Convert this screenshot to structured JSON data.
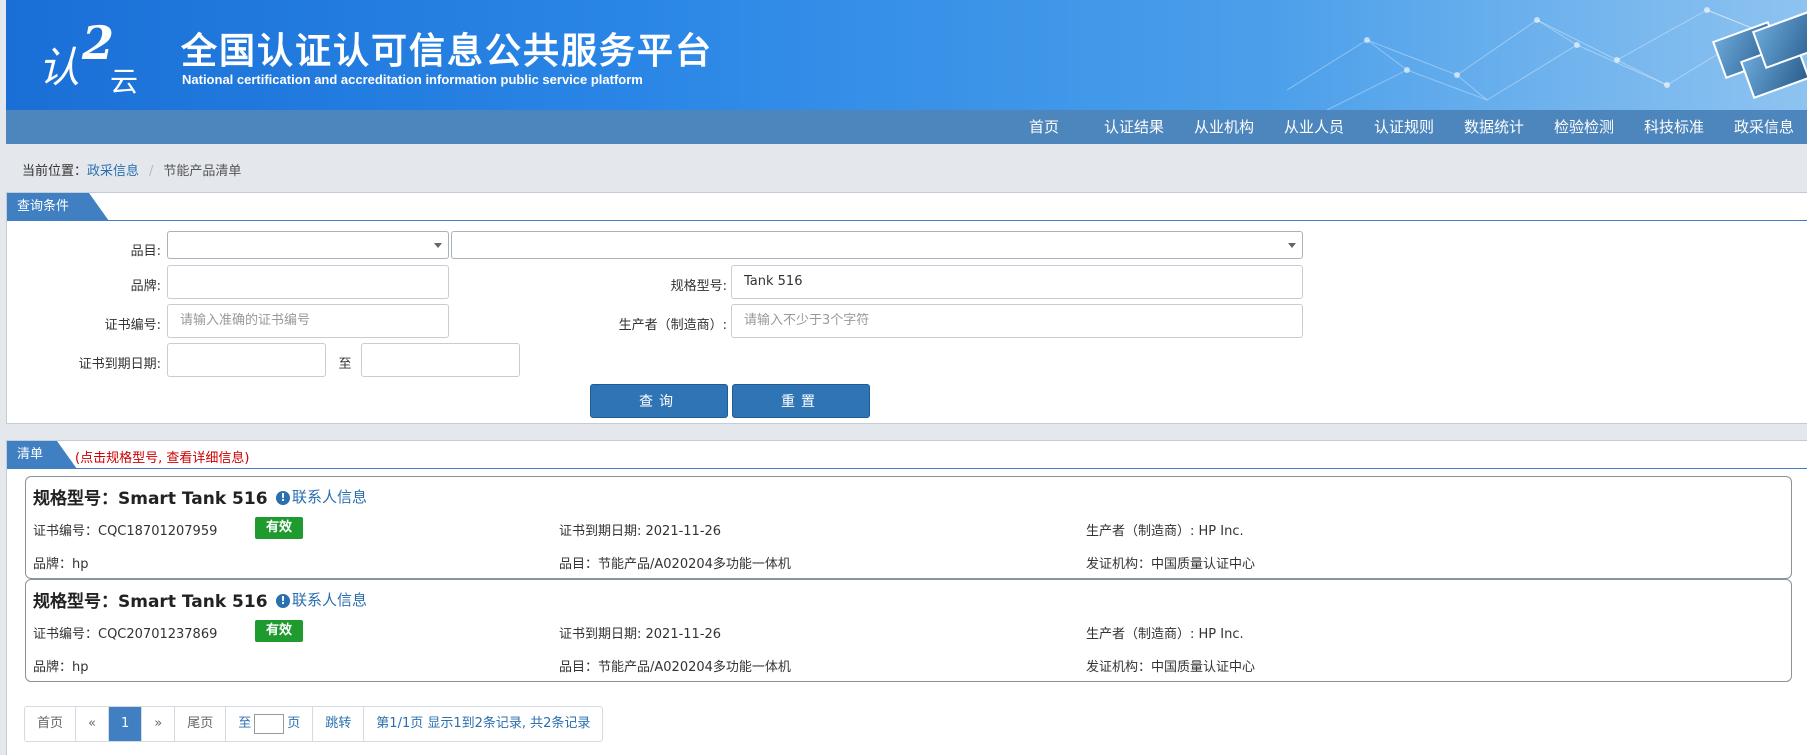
{
  "header": {
    "logo_text": "认证云",
    "title": "全国认证认可信息公共服务平台",
    "subtitle": "National certification and accreditation information public service platform"
  },
  "nav": [
    "首页",
    "认证结果",
    "从业机构",
    "从业人员",
    "认证规则",
    "数据统计",
    "检验检测",
    "科技标准",
    "政采信息"
  ],
  "breadcrumb": {
    "prefix": "当前位置：",
    "parent": "政采信息",
    "separator": "/",
    "current": "节能产品清单"
  },
  "query": {
    "tab": "查询条件",
    "category_label": "品目:",
    "category_value_1": "",
    "category_value_2": "",
    "brand_label": "品牌:",
    "brand_value": "",
    "model_label": "规格型号:",
    "model_value": "Tank 516",
    "cert_no_label": "证书编号:",
    "cert_no_placeholder": "请输入准确的证书编号",
    "maker_label": "生产者（制造商）:",
    "maker_placeholder": "请输入不少于3个字符",
    "expiry_label": "证书到期日期:",
    "expiry_to": "至",
    "search_btn": "查询",
    "reset_btn": "重置"
  },
  "list": {
    "tab": "清单",
    "hint": "(点击规格型号, 查看详细信息)",
    "model_prefix": "规格型号：",
    "contact": "联系人信息",
    "items": [
      {
        "model": "Smart Tank 516",
        "cert_no": "证书编号：CQC18701207959",
        "status": "有效",
        "expiry": "证书到期日期: 2021-11-26",
        "maker": "生产者（制造商）: HP Inc.",
        "brand": "品牌：hp",
        "category": "品目：节能产品/A020204多功能一体机",
        "issuer": "发证机构：中国质量认证中心"
      },
      {
        "model": "Smart Tank 516",
        "cert_no": "证书编号：CQC20701237869",
        "status": "有效",
        "expiry": "证书到期日期: 2021-11-26",
        "maker": "生产者（制造商）: HP Inc.",
        "brand": "品牌：hp",
        "category": "品目：节能产品/A020204多功能一体机",
        "issuer": "发证机构：中国质量认证中心"
      }
    ]
  },
  "pager": {
    "first": "首页",
    "prev": "«",
    "current": "1",
    "next": "»",
    "last": "尾页",
    "to": "至",
    "page": "页",
    "jump": "跳转",
    "summary": "第1/1页  显示1到2条记录, 共2条记录"
  },
  "colors": {
    "banner": "#2a86e6",
    "nav": "#4d86bc",
    "accent": "#3f7fc2",
    "valid_badge": "#1f9a2e",
    "hint": "#cc0000"
  }
}
